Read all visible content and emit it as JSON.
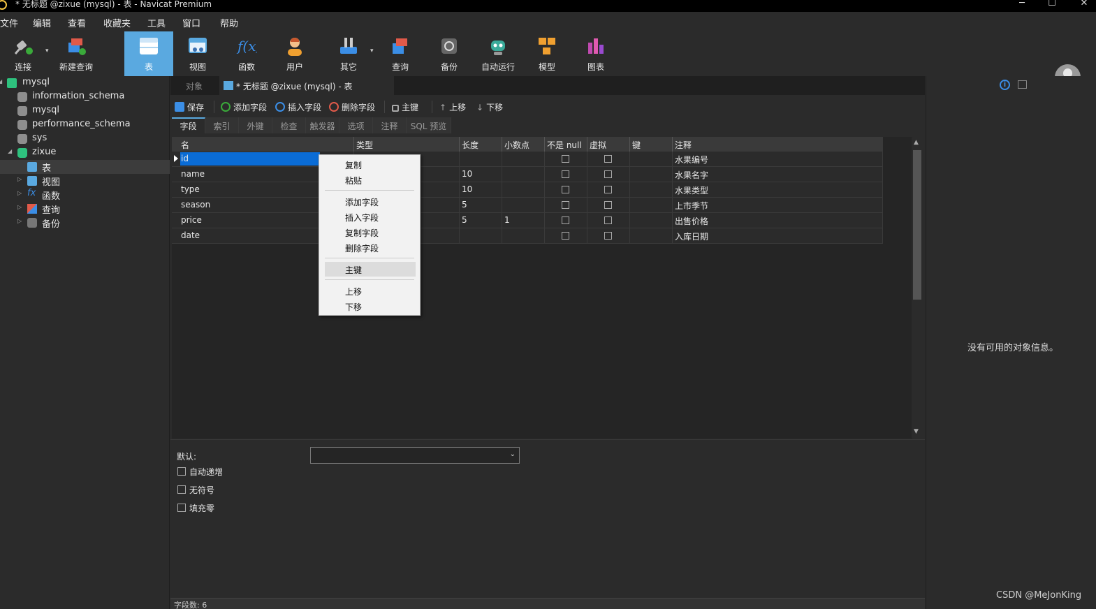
{
  "window": {
    "title": "* 无标题 @zixue (mysql) - 表 - Navicat Premium",
    "min": "─",
    "max": "☐",
    "close": "✕"
  },
  "menu": [
    "文件",
    "编辑",
    "查看",
    "收藏夹",
    "工具",
    "窗口",
    "帮助"
  ],
  "toolbar": {
    "items": [
      "连接",
      "新建查询",
      "表",
      "视图",
      "函数",
      "用户",
      "其它",
      "查询",
      "备份",
      "自动运行",
      "模型",
      "图表"
    ],
    "active": "表",
    "dropdown": "▾"
  },
  "tree": {
    "connection": "mysql",
    "databases": [
      "information_schema",
      "mysql",
      "performance_schema",
      "sys",
      "zixue"
    ],
    "children": [
      "表",
      "视图",
      "函数",
      "查询",
      "备份"
    ],
    "arrow_open": "◢",
    "arrow_closed": "▷"
  },
  "tabs": {
    "objects": "对象",
    "current": "* 无标题 @zixue (mysql) - 表"
  },
  "actions": [
    "保存",
    "添加字段",
    "插入字段",
    "删除字段",
    "主键",
    "上移",
    "下移"
  ],
  "action_icons": {
    "up": "↑",
    "down": "↓"
  },
  "subtabs": [
    "字段",
    "索引",
    "外键",
    "检查",
    "触发器",
    "选项",
    "注释",
    "SQL 预览"
  ],
  "grid": {
    "headers": [
      "名",
      "类型",
      "长度",
      "小数点",
      "不是 null",
      "虚拟",
      "键",
      "注释"
    ],
    "rows": [
      {
        "name": "id",
        "type": "",
        "length": "",
        "decimals": "",
        "comment": "水果编号"
      },
      {
        "name": "name",
        "type": "",
        "length": "10",
        "decimals": "",
        "comment": "水果名字"
      },
      {
        "name": "type",
        "type": "",
        "length": "10",
        "decimals": "",
        "comment": "水果类型"
      },
      {
        "name": "season",
        "type": "",
        "length": "5",
        "decimals": "",
        "comment": "上市季节"
      },
      {
        "name": "price",
        "type": "",
        "length": "5",
        "decimals": "1",
        "comment": "出售价格"
      },
      {
        "name": "date",
        "type": "",
        "length": "",
        "decimals": "",
        "comment": "入库日期"
      }
    ],
    "selected_row": 0,
    "scroll_up": "▲",
    "scroll_down": "▼"
  },
  "context_menu": {
    "items": [
      "复制",
      "粘贴",
      "添加字段",
      "插入字段",
      "复制字段",
      "删除字段",
      "主键",
      "上移",
      "下移"
    ],
    "highlighted": "主键"
  },
  "bottom_panel": {
    "default_label": "默认:",
    "default_value": "",
    "select_caret": "⌄",
    "checks": [
      "自动递增",
      "无符号",
      "填充零"
    ]
  },
  "status": {
    "text": "字段数: 6"
  },
  "right_panel": {
    "info_glyph": "i",
    "message": "没有可用的对象信息。"
  },
  "watermark": "CSDN @MeJonKing",
  "colors": {
    "accent": "#5aa9e0",
    "selection": "#0a6cd6",
    "background": "#2b2b2b"
  }
}
